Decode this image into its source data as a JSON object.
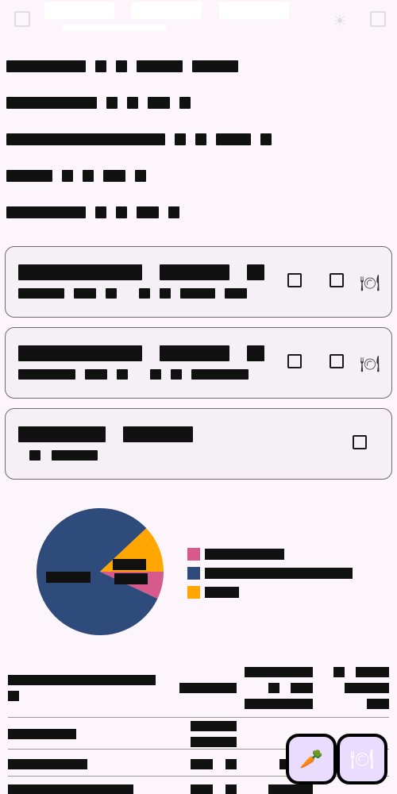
{
  "appbar": {
    "tabs": [
      "",
      "",
      ""
    ],
    "icons": [
      "menu-icon",
      "theme-icon",
      "more-icon"
    ]
  },
  "stats": [
    {
      "label": "",
      "values": [
        "",
        "",
        "",
        ""
      ]
    },
    {
      "label": "",
      "values": [
        "",
        "",
        "",
        ""
      ]
    },
    {
      "label": "",
      "values": [
        "",
        "",
        "",
        ""
      ]
    },
    {
      "label": "",
      "values": [
        "",
        "",
        "",
        ""
      ]
    },
    {
      "label": "",
      "values": [
        "",
        "",
        "",
        ""
      ]
    }
  ],
  "cards": [
    {
      "title": "",
      "subtitle": "",
      "badge": "",
      "meta": ""
    },
    {
      "title": "",
      "subtitle": "",
      "badge": "",
      "meta": ""
    },
    {
      "title": "",
      "subtitle": "",
      "meta": ""
    }
  ],
  "chart_data": {
    "type": "pie",
    "slices": [
      {
        "label": "",
        "value": 0.07,
        "color": "#d65a8c"
      },
      {
        "label": "",
        "value": 0.81,
        "color": "#2f4b7c"
      },
      {
        "label": "",
        "value": 0.12,
        "color": "#ffa600"
      }
    ]
  },
  "table": {
    "headers": [
      "",
      "",
      "",
      ""
    ],
    "rows": [
      [
        "",
        "",
        "",
        ""
      ],
      [
        "",
        "",
        "",
        ""
      ],
      [
        "",
        "",
        "",
        ""
      ]
    ]
  },
  "fabs": [
    {
      "icon": "carrot-icon"
    },
    {
      "icon": "serving-dish-icon"
    }
  ]
}
